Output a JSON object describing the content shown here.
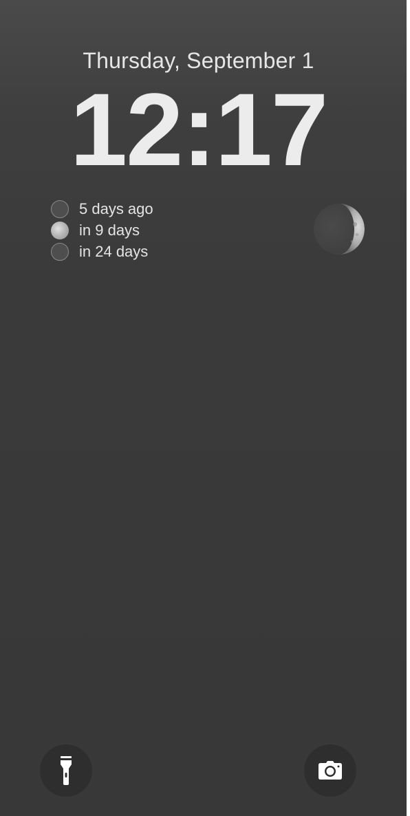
{
  "lockscreen": {
    "date": "Thursday, September 1",
    "time": "12:17"
  },
  "moon_widget": {
    "phases": [
      {
        "label": "5 days ago",
        "icon": "new-moon-icon"
      },
      {
        "label": "in 9 days",
        "icon": "full-moon-icon"
      },
      {
        "label": "in 24 days",
        "icon": "new-moon-icon"
      }
    ],
    "current_phase_icon": "waxing-crescent-moon-icon"
  },
  "quick_actions": {
    "left_icon": "flashlight-icon",
    "right_icon": "camera-icon"
  },
  "colors": {
    "background": "#3a3a3a",
    "text": "#e8e8e8",
    "button_background": "#2e2e2e"
  }
}
